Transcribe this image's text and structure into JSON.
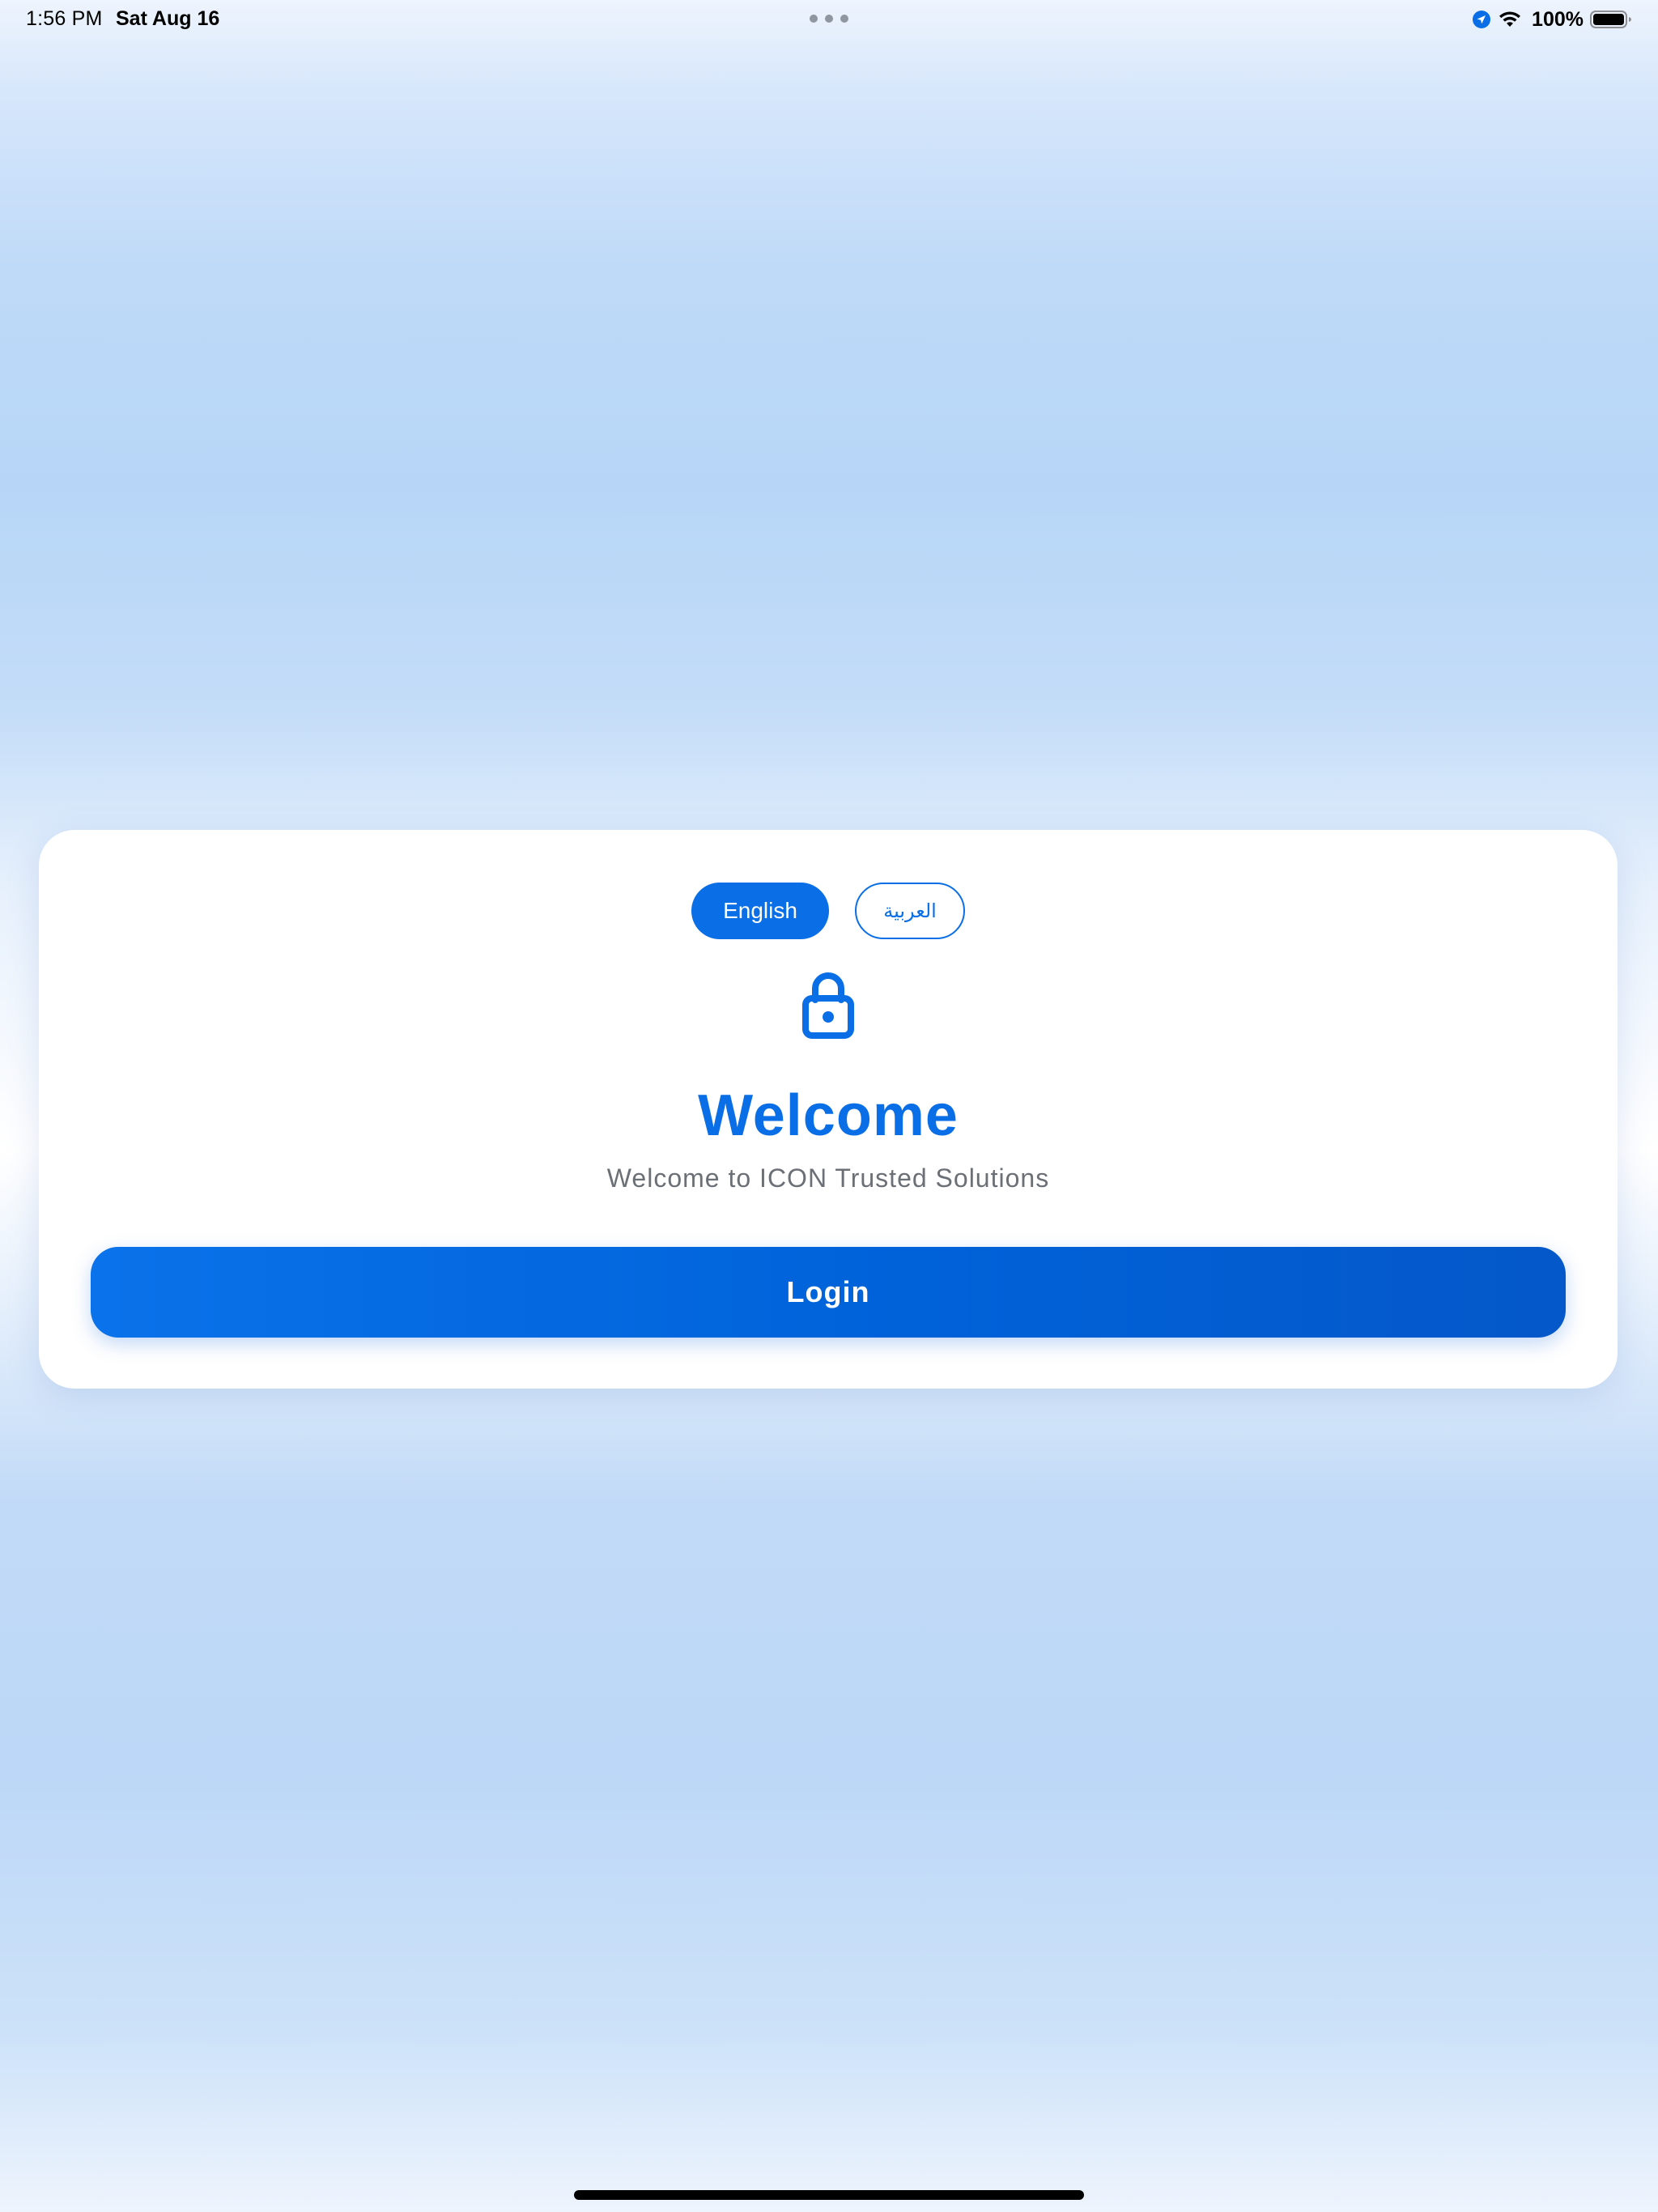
{
  "status_bar": {
    "time": "1:56 PM",
    "date": "Sat Aug 16",
    "battery_text": "100%",
    "icons": [
      "location-icon",
      "wifi-icon",
      "battery-icon"
    ]
  },
  "card": {
    "languages": {
      "english": "English",
      "arabic": "العربية",
      "selected": "English"
    },
    "title": "Welcome",
    "subtitle": "Welcome to ICON Trusted Solutions",
    "login_label": "Login",
    "icon": "lock-icon"
  },
  "colors": {
    "accent": "#0a6ee6",
    "subtitle": "#6b6f76",
    "background": "#b7d6f7",
    "card": "#ffffff"
  }
}
